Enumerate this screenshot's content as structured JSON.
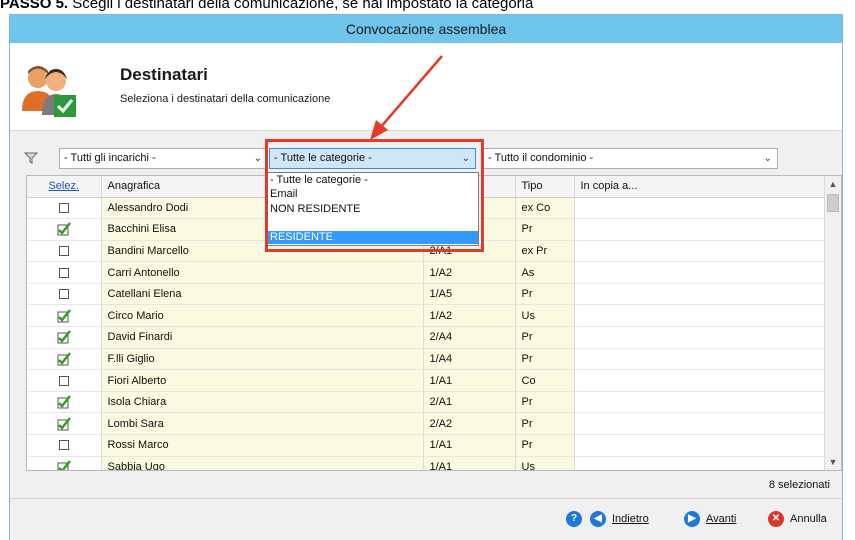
{
  "caption": {
    "bold": "PASSO 5.",
    "text": " Scegli i destinatari della comunicazione, se hai impostato la categoria"
  },
  "window": {
    "title": "Convocazione assemblea"
  },
  "header": {
    "title": "Destinatari",
    "subtitle": "Seleziona i destinatari della comunicazione"
  },
  "filters": {
    "incarichi": "- Tutti gli incarichi -",
    "categorie": "- Tutte le categorie -",
    "condominio": "- Tutto il condominio -"
  },
  "dropdown": {
    "items": [
      "- Tutte le categorie -",
      "Email",
      "NON RESIDENTE",
      "",
      "RESIDENTE"
    ]
  },
  "grid": {
    "columns": {
      "selez": "Selez.",
      "anagrafica": "Anagrafica",
      "unita": "",
      "tipo": "Tipo",
      "copia": "In copia a..."
    },
    "rows": [
      {
        "checked": false,
        "name": "Alessandro Dodi",
        "unit": "",
        "tipo": "ex Co"
      },
      {
        "checked": true,
        "name": "Bacchini Elisa",
        "unit": "",
        "tipo": "Pr"
      },
      {
        "checked": false,
        "name": "Bandini Marcello",
        "unit": "2/A1",
        "tipo": "ex Pr"
      },
      {
        "checked": false,
        "name": "Carri Antonello",
        "unit": "1/A2",
        "tipo": "As"
      },
      {
        "checked": false,
        "name": "Catellani Elena",
        "unit": "1/A5",
        "tipo": "Pr"
      },
      {
        "checked": true,
        "name": "Circo Mario",
        "unit": "1/A2",
        "tipo": "Us"
      },
      {
        "checked": true,
        "name": "David Finardi",
        "unit": "2/A4",
        "tipo": "Pr"
      },
      {
        "checked": true,
        "name": "F.lli Giglio",
        "unit": "1/A4",
        "tipo": "Pr"
      },
      {
        "checked": false,
        "name": "Fiori Alberto",
        "unit": "1/A1",
        "tipo": "Co"
      },
      {
        "checked": true,
        "name": "Isola Chiara",
        "unit": "2/A1",
        "tipo": "Pr"
      },
      {
        "checked": true,
        "name": "Lombi Sara",
        "unit": "2/A2",
        "tipo": "Pr"
      },
      {
        "checked": false,
        "name": "Rossi Marco",
        "unit": "1/A1",
        "tipo": "Pr"
      },
      {
        "checked": true,
        "name": "Sabbia Ugo",
        "unit": "1/A1",
        "tipo": "Us"
      }
    ]
  },
  "status": {
    "count": "8 selezionati"
  },
  "footer": {
    "back": "Indietro",
    "next": "Avanti",
    "cancel": "Annulla"
  },
  "colors": {
    "titlebar": "#6fc5ec",
    "highlight": "#3399ff",
    "annotation": "#e53a2a",
    "checkmark": "#3a9a2a"
  },
  "icons": [
    "users-check-icon",
    "funnel-icon",
    "help-icon",
    "back-arrow-icon",
    "forward-arrow-icon",
    "cancel-icon"
  ]
}
